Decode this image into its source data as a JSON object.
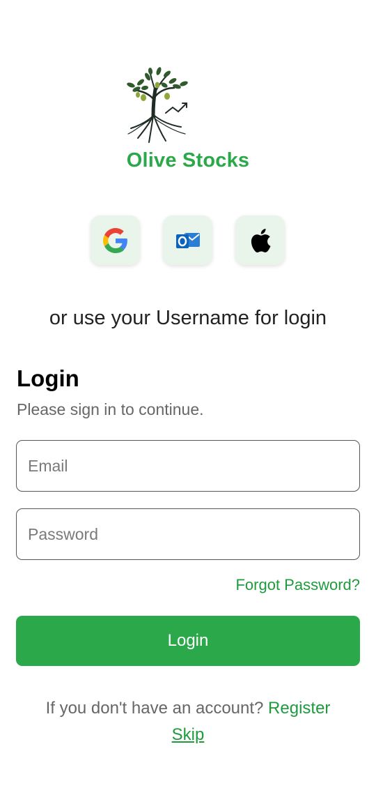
{
  "app": {
    "name": "Olive Stocks",
    "brand_color": "#2ba84a"
  },
  "social": [
    {
      "id": "google",
      "icon": "google-icon"
    },
    {
      "id": "outlook",
      "icon": "outlook-icon"
    },
    {
      "id": "apple",
      "icon": "apple-icon"
    }
  ],
  "alt_login_text": "or use your Username for login",
  "login": {
    "title": "Login",
    "subtitle": "Please sign in to continue.",
    "email_placeholder": "Email",
    "password_placeholder": "Password",
    "forgot_label": "Forgot Password?",
    "submit_label": "Login"
  },
  "footer": {
    "prompt": "If you don't have an account?",
    "register_label": "Register",
    "skip_label": "Skip"
  }
}
